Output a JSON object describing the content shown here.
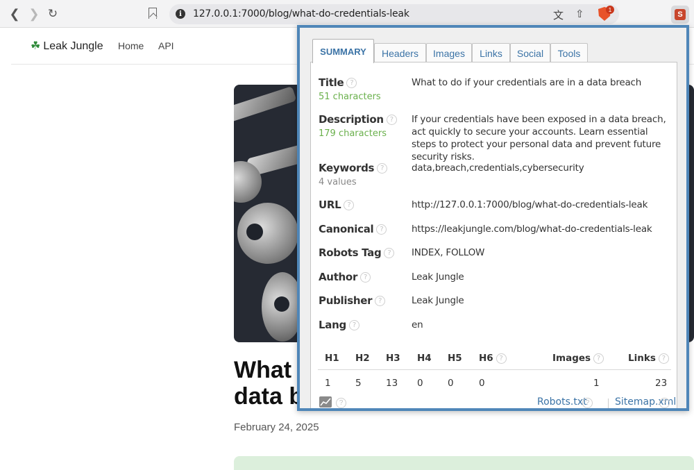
{
  "browser": {
    "url": "127.0.0.1:7000/blog/what-do-credentials-leak",
    "brave_badge": "1"
  },
  "site": {
    "logo_text": "Leak Jungle",
    "nav": [
      "Home",
      "API"
    ]
  },
  "article": {
    "title": "What to do if your credentials are in a data breach",
    "title_visible": "What\ndata b",
    "date": "February 24, 2025"
  },
  "popup": {
    "tabs": [
      "SUMMARY",
      "Headers",
      "Images",
      "Links",
      "Social",
      "Tools"
    ],
    "active_tab": "SUMMARY",
    "rows": {
      "title": {
        "label": "Title",
        "sub": "51 characters",
        "value": "What to do if your credentials are in a data breach"
      },
      "description": {
        "label": "Description",
        "sub": "179 characters",
        "value": "If your credentials have been exposed in a data breach, act quickly to secure your accounts. Learn essential steps to protect your personal data and prevent future security risks."
      },
      "keywords": {
        "label": "Keywords",
        "sub": "4 values",
        "value": "data,breach,credentials,cybersecurity"
      },
      "url": {
        "label": "URL",
        "value": "http://127.0.0.1:7000/blog/what-do-credentials-leak"
      },
      "canonical": {
        "label": "Canonical",
        "value": "https://leakjungle.com/blog/what-do-credentials-leak"
      },
      "robots": {
        "label": "Robots Tag",
        "value": "INDEX, FOLLOW"
      },
      "author": {
        "label": "Author",
        "value": "Leak Jungle"
      },
      "publisher": {
        "label": "Publisher",
        "value": "Leak Jungle"
      },
      "lang": {
        "label": "Lang",
        "value": "en"
      }
    },
    "headings": {
      "h1": {
        "label": "H1",
        "value": "1"
      },
      "h2": {
        "label": "H2",
        "value": "5"
      },
      "h3": {
        "label": "H3",
        "value": "13"
      },
      "h4": {
        "label": "H4",
        "value": "0"
      },
      "h5": {
        "label": "H5",
        "value": "0"
      },
      "h6": {
        "label": "H6",
        "value": "0"
      },
      "images": {
        "label": "Images",
        "value": "1"
      },
      "links": {
        "label": "Links",
        "value": "23"
      }
    },
    "footer": {
      "robots_link": "Robots.txt",
      "sitemap_link": "Sitemap.xml"
    }
  },
  "colors": {
    "popup_border": "#4f86b8",
    "link_blue": "#3b73a6",
    "count_green": "#6ab04c"
  }
}
